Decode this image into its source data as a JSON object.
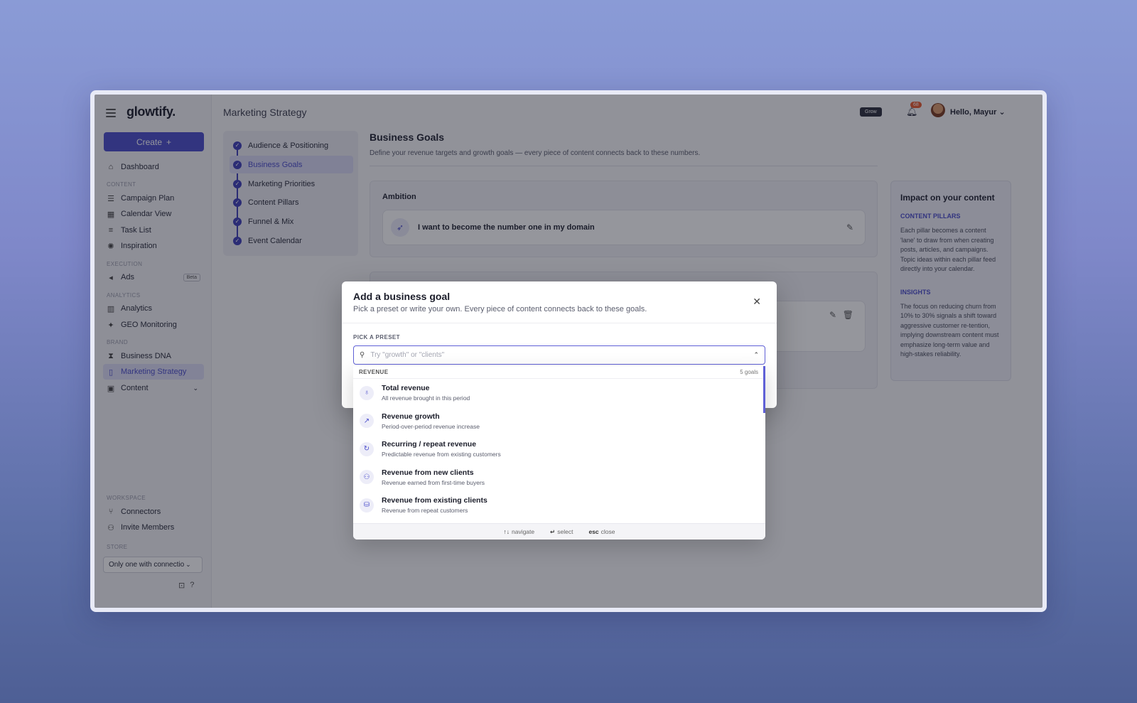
{
  "app": {
    "logo": "glowtify.",
    "page_title": "Marketing Strategy"
  },
  "header": {
    "plan_badge": "Grow",
    "notification_count": "68",
    "greeting": "Hello, Mayur"
  },
  "sidebar": {
    "create_label": "Create",
    "dashboard": "Dashboard",
    "sections": {
      "content": "CONTENT",
      "execution": "EXECUTION",
      "analytics": "ANALYTICS",
      "brand": "BRAND",
      "workspace": "WORKSPACE",
      "store": "STORE"
    },
    "content_items": [
      "Campaign Plan",
      "Calendar View",
      "Task List",
      "Inspiration"
    ],
    "execution_items": [
      "Ads"
    ],
    "beta_badge": "Beta",
    "analytics_items": [
      "Analytics",
      "GEO Monitoring"
    ],
    "brand_items": [
      "Business DNA",
      "Marketing Strategy",
      "Content"
    ],
    "workspace_items": [
      "Connectors",
      "Invite Members"
    ],
    "store_value": "Only one with connectio"
  },
  "steps": [
    "Audience & Positioning",
    "Business Goals",
    "Marketing Priorities",
    "Content Pillars",
    "Funnel & Mix",
    "Event Calendar"
  ],
  "main": {
    "title": "Business Goals",
    "subtitle": "Define your revenue targets and growth goals — every piece of content connects back to these numbers.",
    "ambition_label": "Ambition",
    "ambition_text": "I want to become the number one in my domain"
  },
  "impact": {
    "title": "Impact on your content",
    "pillars_heading": "CONTENT PILLARS",
    "pillars_text": "Each pillar becomes a content 'lane' to draw from when creating posts, articles, and campaigns. Topic ideas within each pillar feed directly into your calendar.",
    "insights_heading": "INSIGHTS",
    "insights_text": "The focus on reducing churn from 10% to 30% signals a shift toward aggressive customer re-tention, implying downstream content must emphasize long-term value and high-stakes reliability."
  },
  "modal": {
    "title": "Add a business goal",
    "subtitle": "Pick a preset or write your own. Every piece of content connects back to these goals.",
    "preset_label": "PICK A PRESET",
    "search_placeholder": "Try \"growth\" or \"clients\"",
    "category": "REVENUE",
    "category_count": "5 goals",
    "items": [
      {
        "title": "Total revenue",
        "desc": "All revenue brought in this period",
        "icon": "money-bag-icon"
      },
      {
        "title": "Revenue growth",
        "desc": "Period-over-period revenue increase",
        "icon": "trending-up-icon"
      },
      {
        "title": "Recurring / repeat revenue",
        "desc": "Predictable revenue from existing customers",
        "icon": "refresh-icon"
      },
      {
        "title": "Revenue from new clients",
        "desc": "Revenue earned from first-time buyers",
        "icon": "user-plus-icon"
      },
      {
        "title": "Revenue from existing clients",
        "desc": "Revenue from repeat customers",
        "icon": "coins-icon"
      }
    ],
    "footer": {
      "navigate_key": "↑↓",
      "navigate": "navigate",
      "select_key": "↵",
      "select": "select",
      "close_key": "esc",
      "close": "close"
    }
  },
  "colors": {
    "accent": "#4b4dcb",
    "badge_red": "#e8592f"
  }
}
